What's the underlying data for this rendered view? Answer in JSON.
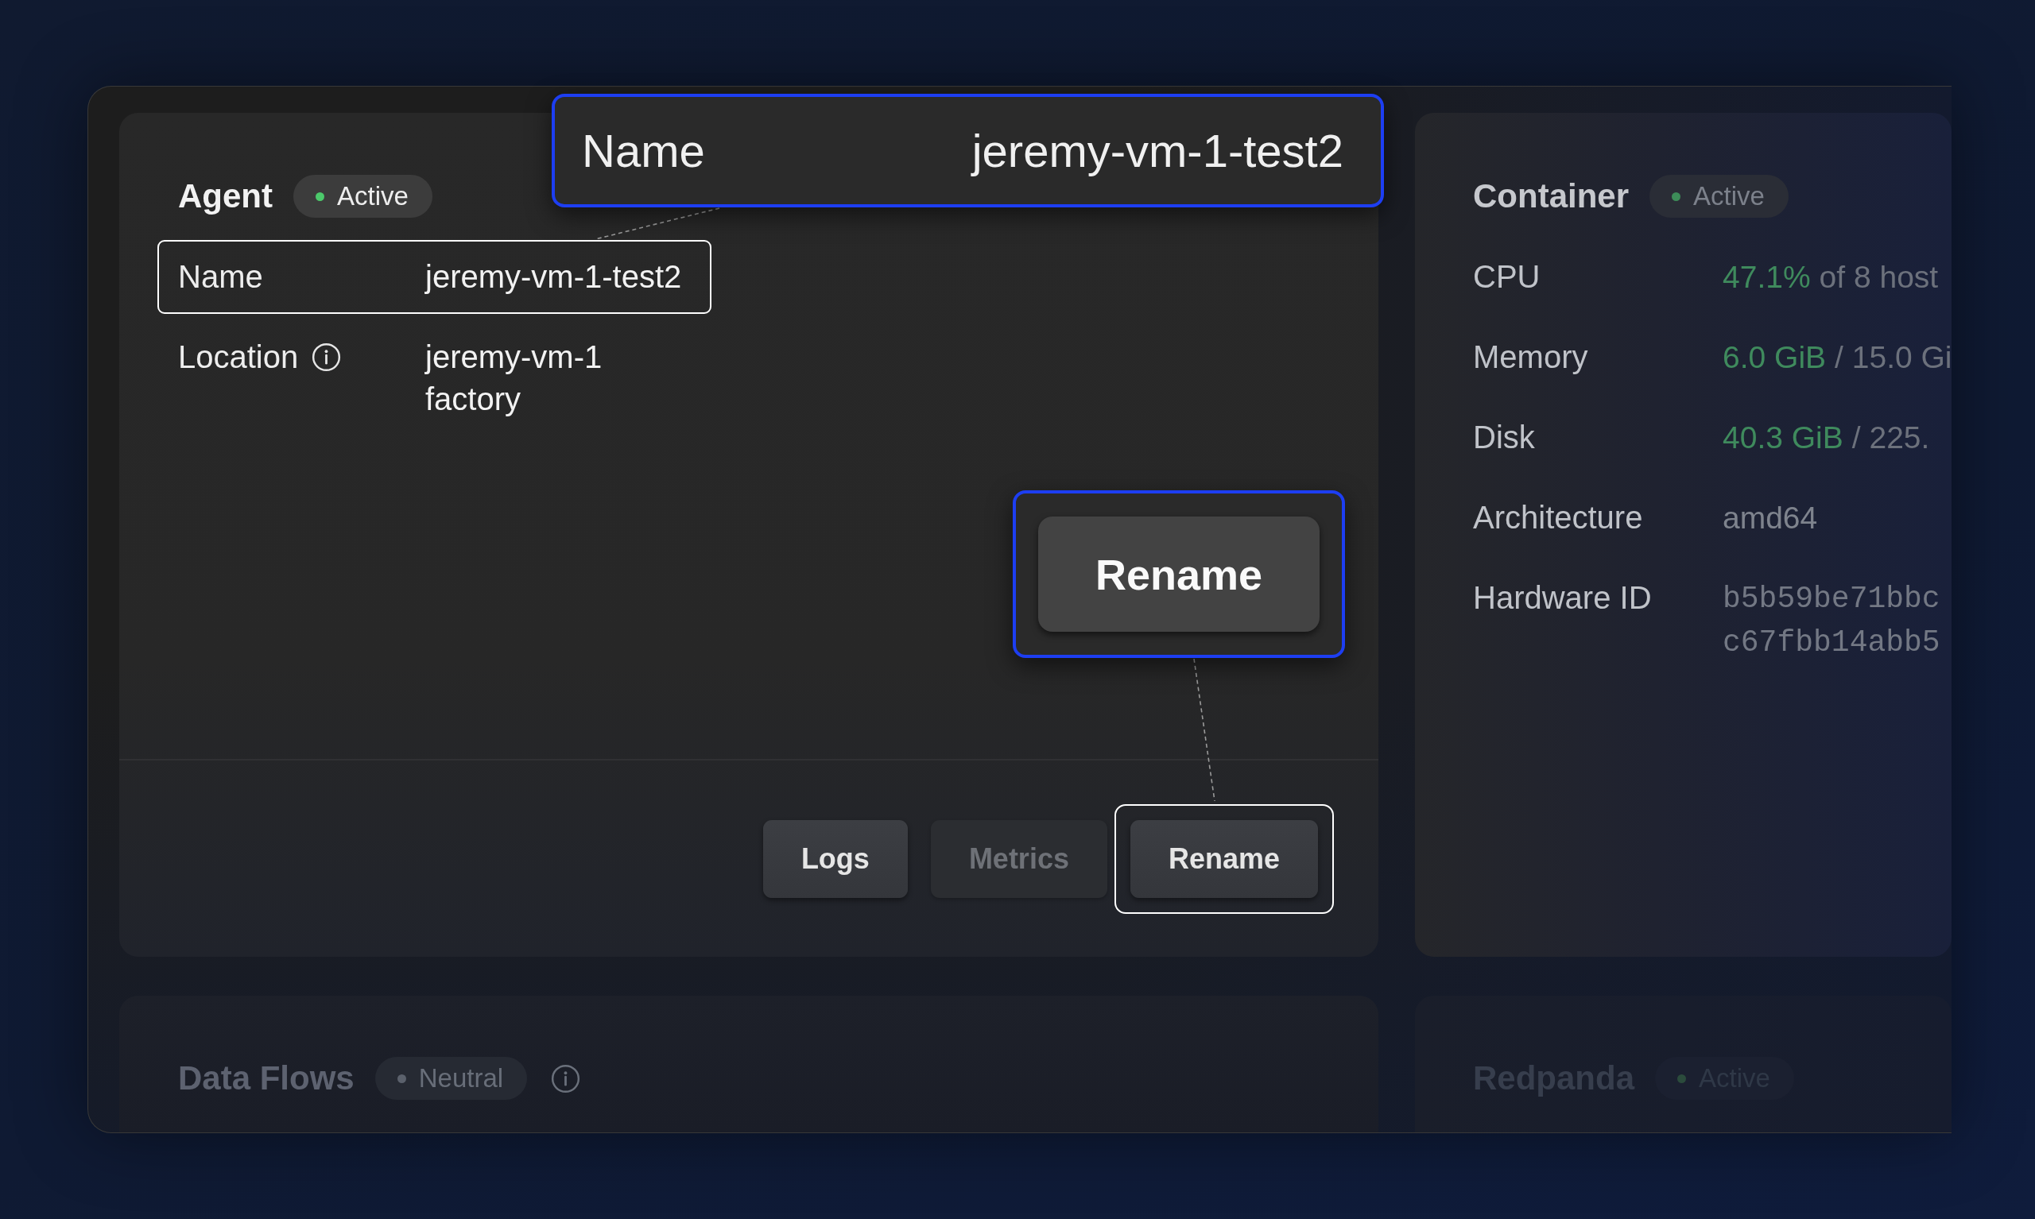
{
  "agent": {
    "title": "Agent",
    "status": {
      "label": "Active",
      "color": "#4cc96b"
    },
    "fields": [
      {
        "label": "Name",
        "info": false,
        "lines": [
          "jeremy-vm-1-test2"
        ],
        "highlighted": true
      },
      {
        "label": "Location",
        "info": true,
        "lines": [
          "jeremy-vm-1",
          "factory"
        ],
        "highlighted": false
      }
    ],
    "actions": [
      {
        "label": "Logs",
        "disabled": false,
        "highlighted": false
      },
      {
        "label": "Metrics",
        "disabled": true,
        "highlighted": false
      },
      {
        "label": "Rename",
        "disabled": false,
        "highlighted": true
      }
    ]
  },
  "container": {
    "title": "Container",
    "status": {
      "label": "Active",
      "color": "#3d8c59"
    },
    "rows": [
      {
        "kind": "usage",
        "label": "CPU",
        "used": "47.1%",
        "total": "of 8 host"
      },
      {
        "kind": "usage",
        "label": "Memory",
        "used": "6.0 GiB",
        "total": "/ 15.0 Gi"
      },
      {
        "kind": "usage",
        "label": "Disk",
        "used": "40.3 GiB",
        "total": "/ 225."
      },
      {
        "kind": "text",
        "label": "Architecture",
        "value": "amd64"
      },
      {
        "kind": "mono",
        "label": "Hardware ID",
        "lines": [
          "b5b59be71bbc",
          "c67fbb14abb5"
        ]
      }
    ]
  },
  "bottom_panels": [
    {
      "title": "Data Flows",
      "status": {
        "label": "Neutral",
        "color": "#5b616c"
      },
      "info": true
    },
    {
      "title": "Redpanda",
      "status": {
        "label": "Active",
        "color": "#2b4b3c"
      },
      "info": false
    }
  ],
  "callouts": [
    {
      "kind": "field",
      "label": "Name",
      "value": "jeremy-vm-1-test2"
    },
    {
      "kind": "button",
      "label": "Rename"
    }
  ]
}
